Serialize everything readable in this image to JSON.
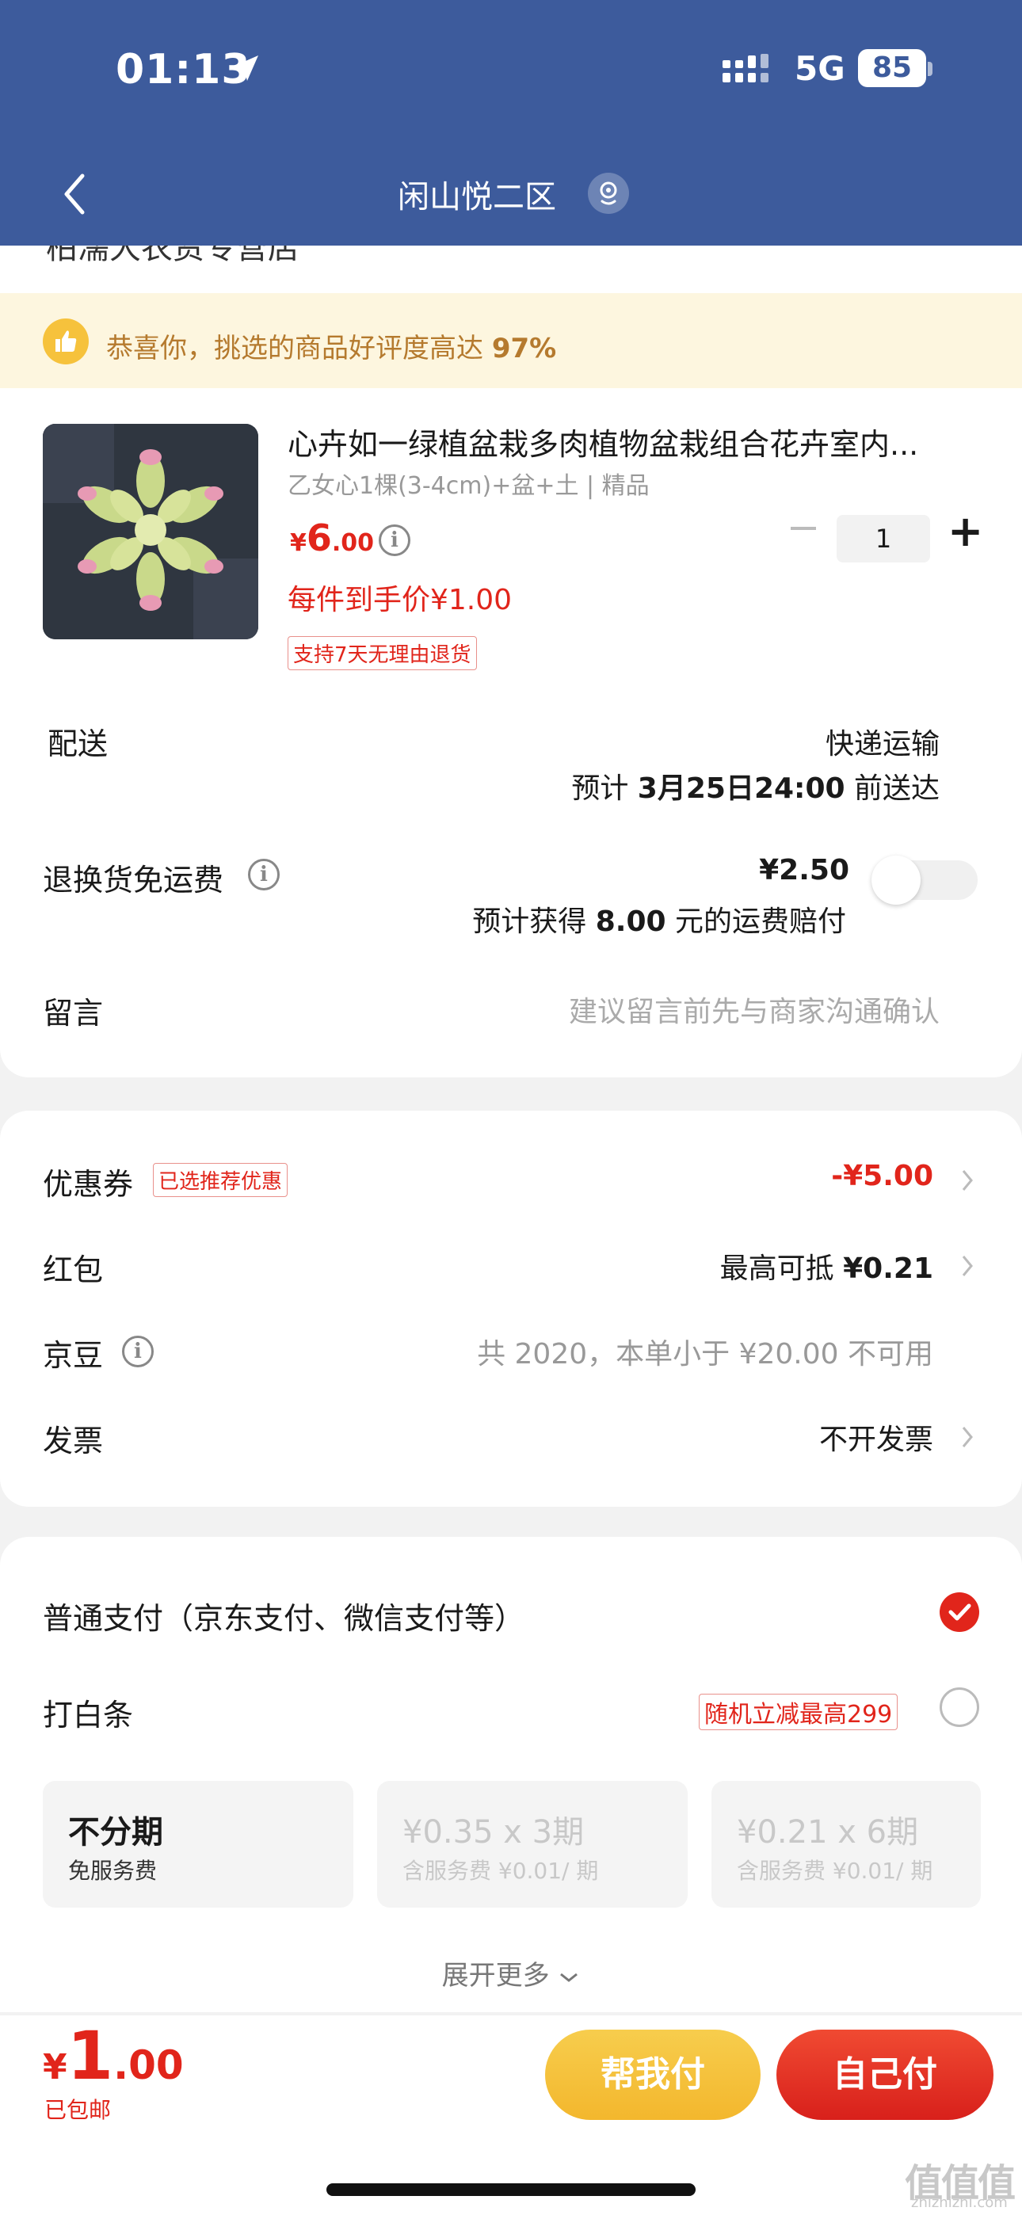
{
  "status_bar": {
    "time": "01:13",
    "network": "5G",
    "battery": "85"
  },
  "nav": {
    "title": "闲山悦二区"
  },
  "shop": {
    "name_partial": "柏濡大农资专营店"
  },
  "banner": {
    "text_prefix": "恭喜你，挑选的商品好评度高达 ",
    "rating": "97%"
  },
  "product": {
    "title": "心卉如一绿植盆栽多肉植物盆栽组合花卉室内...",
    "spec": "乙女心1棵(3-4cm)+盆+土 | 精品",
    "price_currency": "¥",
    "price_int": "6",
    "price_dec": ".00",
    "unit_price": "每件到手价¥1.00",
    "return_tag": "支持7天无理由退货",
    "quantity": "1"
  },
  "delivery": {
    "label": "配送",
    "method": "快递运输",
    "eta_prefix": "预计 ",
    "eta_date": "3月25日24:00",
    "eta_suffix": " 前送达"
  },
  "return_shipping": {
    "label": "退换货免运费",
    "price": "¥2.50",
    "note_prefix": "预计获得 ",
    "note_amount": "8.00",
    "note_suffix": " 元的运费赔付",
    "enabled": false
  },
  "message": {
    "label": "留言",
    "placeholder": "建议留言前先与商家沟通确认"
  },
  "discounts": {
    "coupon": {
      "label": "优惠券",
      "tag": "已选推荐优惠",
      "value": "-¥5.00"
    },
    "red_packet": {
      "label": "红包",
      "value_prefix": "最高可抵 ",
      "value": "¥0.21"
    },
    "jd_beans": {
      "label": "京豆",
      "value": "共 2020，本单小于 ¥20.00 不可用"
    },
    "invoice": {
      "label": "发票",
      "value": "不开发票"
    }
  },
  "payment": {
    "normal": {
      "label": "普通支付（京东支付、微信支付等）",
      "selected": true
    },
    "baitiao": {
      "label": "打白条",
      "promo": "随机立减最高299",
      "selected": false
    },
    "plans": [
      {
        "main": "不分期",
        "sub": "免服务费"
      },
      {
        "main": "¥0.35 x 3期",
        "sub": "含服务费 ¥0.01/ 期"
      },
      {
        "main": "¥0.21 x 6期",
        "sub": "含服务费 ¥0.01/ 期"
      }
    ],
    "expand": "展开更多"
  },
  "footer": {
    "total_currency": "¥",
    "total_int": "1",
    "total_dec": ".00",
    "shipping": "已包邮",
    "help_pay": "帮我付",
    "self_pay": "自己付"
  },
  "watermark": {
    "main": "值值值",
    "sub": "zhizhizhi.com"
  },
  "colors": {
    "header": "#3d5b9c",
    "accent_red": "#e1251b",
    "help_yellow": "#f3b72d"
  }
}
